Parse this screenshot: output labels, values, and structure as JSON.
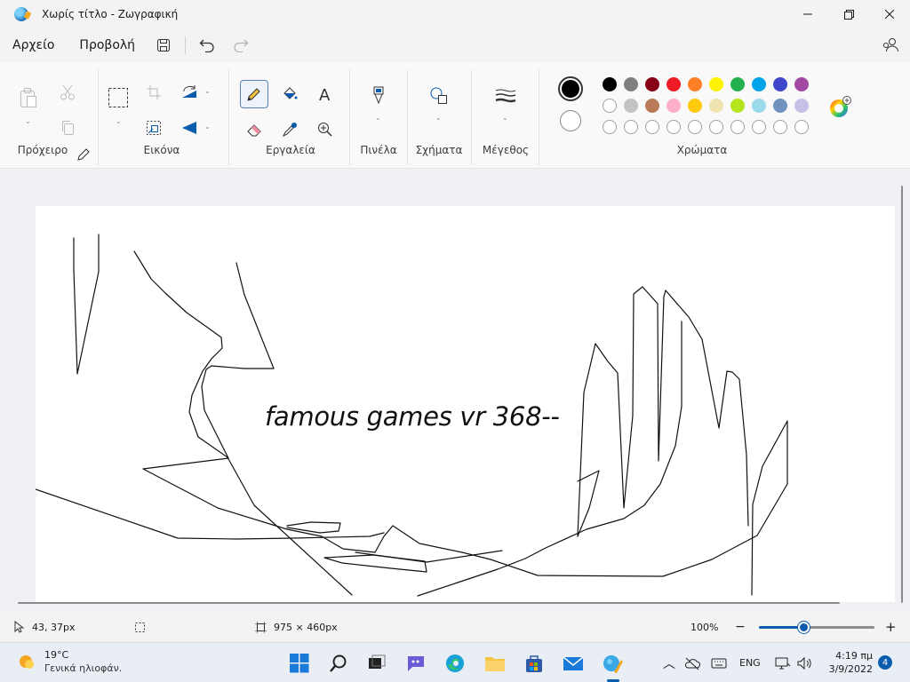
{
  "window": {
    "title": "Χωρίς τίτλο - Ζωγραφική",
    "controls": [
      "minimize",
      "maximize",
      "close"
    ]
  },
  "menu": {
    "file": "Αρχείο",
    "view": "Προβολή"
  },
  "ribbon": {
    "clipboard_label": "Πρόχειρο",
    "image_label": "Εικόνα",
    "tools_label": "Εργαλεία",
    "brushes_label": "Πινέλα",
    "shapes_label": "Σχήματα",
    "size_label": "Μέγεθος",
    "colors_label": "Χρώματα",
    "active_tool": "pencil"
  },
  "palette": {
    "color1": "#000000",
    "color2": "#ffffff",
    "row1": [
      "#000000",
      "#7f7f7f",
      "#880015",
      "#ed1c24",
      "#ff7f27",
      "#fff200",
      "#22b14c",
      "#00a2e8",
      "#3f48cc",
      "#a349a4"
    ],
    "row2": [
      "#ffffff",
      "#c3c3c3",
      "#b97a57",
      "#ffaec9",
      "#ffc90e",
      "#efe4b0",
      "#b5e61d",
      "#99d9ea",
      "#7092be",
      "#c8bfe7"
    ],
    "row3_empty": 10
  },
  "canvas": {
    "text": "famous games vr 368--"
  },
  "status": {
    "cursor_pos": "43, 37px",
    "canvas_size": "975 × 460px",
    "zoom": "100%",
    "zoom_level": 0.5
  },
  "taskbar": {
    "temp": "19°C",
    "weather": "Γενικά ηλιοφάν.",
    "lang": "ENG",
    "time": "4:19 πμ",
    "date": "3/9/2022",
    "notifications": "4"
  }
}
